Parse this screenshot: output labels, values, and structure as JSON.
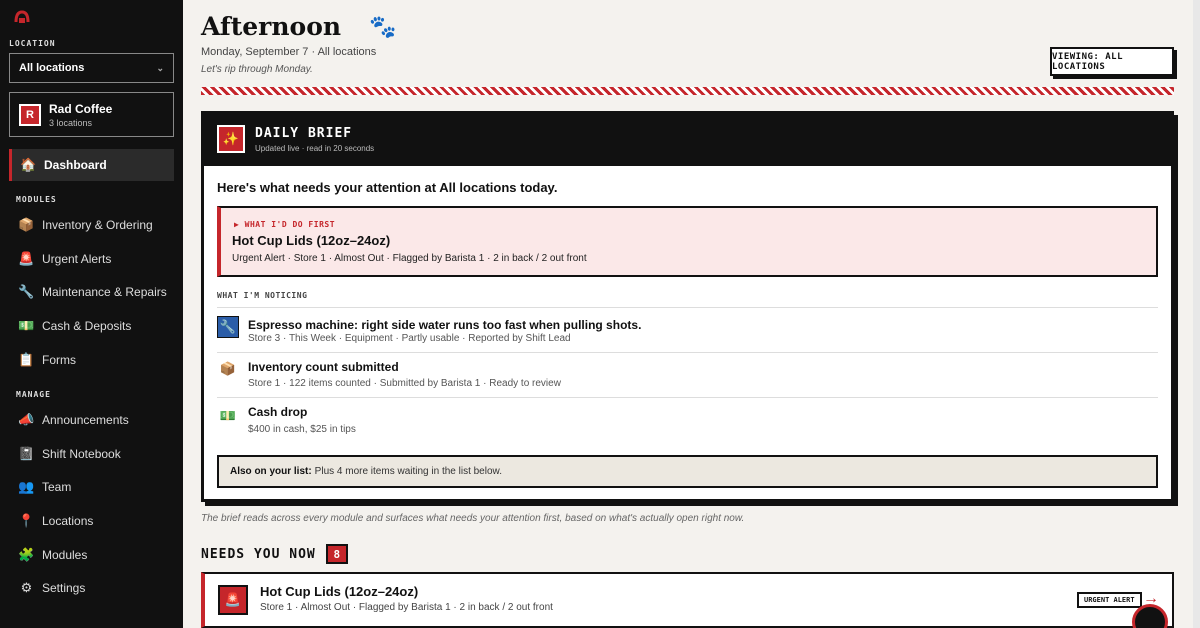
{
  "sidebar": {
    "location_section": "LOCATION",
    "location_value": "All locations",
    "org": {
      "initial": "R",
      "name": "Rad Coffee",
      "sub": "3 locations"
    },
    "dashboard_label": "Dashboard",
    "modules_section": "MODULES",
    "modules": [
      {
        "label": "Inventory & Ordering",
        "icon": "📦"
      },
      {
        "label": "Urgent Alerts",
        "icon": "🚨"
      },
      {
        "label": "Maintenance & Repairs",
        "icon": "🔧"
      },
      {
        "label": "Cash & Deposits",
        "icon": "💵"
      },
      {
        "label": "Forms",
        "icon": "📋"
      }
    ],
    "manage_section": "MANAGE",
    "manage": [
      {
        "label": "Announcements",
        "icon": "📣"
      },
      {
        "label": "Shift Notebook",
        "icon": "📓"
      },
      {
        "label": "Team",
        "icon": "👥"
      },
      {
        "label": "Locations",
        "icon": "📍"
      },
      {
        "label": "Modules",
        "icon": "🧩"
      },
      {
        "label": "Settings",
        "icon": "⚙"
      }
    ]
  },
  "header": {
    "title": "Afternoon",
    "date_line": "Monday, September 7 · All locations",
    "tagline": "Let's rip through Monday.",
    "view_button": "VIEWING: ALL LOCATIONS"
  },
  "brief": {
    "title": "DAILY BRIEF",
    "subtitle": "Updated live · read in 20 seconds",
    "headline": "Here's what needs your attention at All locations today.",
    "first": {
      "label": "▶ WHAT I'D DO FIRST",
      "title": "Hot Cup Lids (12oz–24oz)",
      "meta": "Urgent Alert · Store 1 · Almost Out · Flagged by Barista 1 · 2 in back / 2 out front"
    },
    "noticing_label": "WHAT I'M NOTICING",
    "noticing": [
      {
        "title": "Espresso machine: right side water runs too fast when pulling shots.",
        "meta": "Store 3 · This Week · Equipment · Partly usable · Reported by Shift Lead",
        "icon": "🔧"
      },
      {
        "title": "Inventory count submitted",
        "meta": "Store 1 · 122 items counted · Submitted by Barista 1 · Ready to review",
        "icon": "📦"
      },
      {
        "title": "Cash drop",
        "meta": "$400 in cash, $25 in tips",
        "icon": "💵"
      }
    ],
    "also_label": "Also on your list:",
    "also_text": "Plus 4 more items waiting in the list below.",
    "footnote": "The brief reads across every module and surfaces what needs your attention first, based on what's actually open right now."
  },
  "needs": {
    "title": "NEEDS YOU NOW",
    "count": "8",
    "card": {
      "title": "Hot Cup Lids (12oz–24oz)",
      "meta": "Store 1 · Almost Out · Flagged by Barista 1 · 2 in back / 2 out front",
      "badge": "URGENT ALERT",
      "arrow": "→"
    }
  },
  "colors": {
    "accent": "#c5262b",
    "ink": "#111111",
    "paper": "#f4f2ee"
  }
}
